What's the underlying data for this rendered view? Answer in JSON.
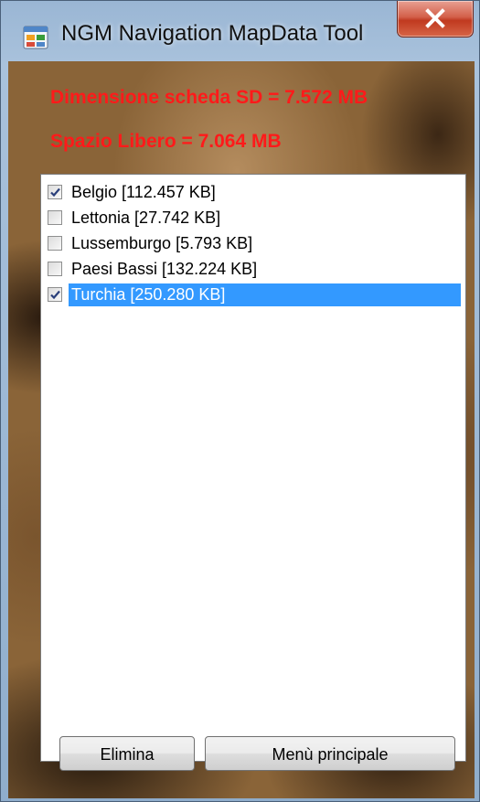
{
  "window": {
    "title": "NGM Navigation MapData Tool",
    "close_icon": "close-x-icon",
    "app_icon": "window-app-icon"
  },
  "info": {
    "card_size": "Dimensione scheda SD = 7.572 MB",
    "free_space": "Spazio Libero = 7.064 MB",
    "text_color": "#ff1a1a"
  },
  "map_list": {
    "items": [
      {
        "label": "Belgio  [112.457 KB]",
        "checked": true,
        "selected": false
      },
      {
        "label": "Lettonia  [27.742 KB]",
        "checked": false,
        "selected": false
      },
      {
        "label": "Lussemburgo  [5.793 KB]",
        "checked": false,
        "selected": false
      },
      {
        "label": "Paesi Bassi  [132.224 KB]",
        "checked": false,
        "selected": false
      },
      {
        "label": "Turchia  [250.280 KB]",
        "checked": true,
        "selected": true
      }
    ],
    "selection_color": "#3399ff"
  },
  "buttons": {
    "delete_label": "Elimina",
    "main_menu_label": "Menù principale"
  }
}
